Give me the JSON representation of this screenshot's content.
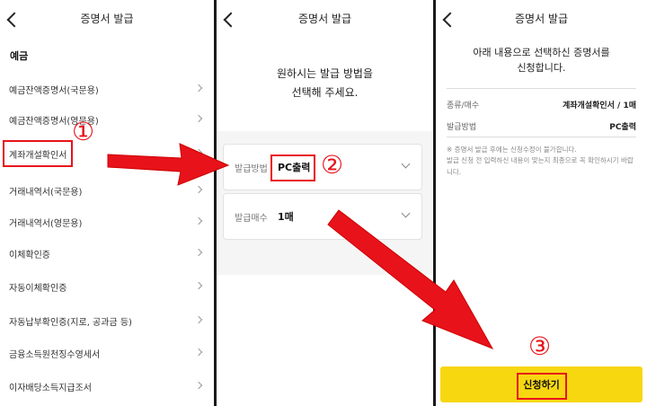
{
  "panel1": {
    "title": "증명서 발급",
    "section": "예금",
    "items": [
      {
        "label": "예금잔액증명서(국문용)"
      },
      {
        "label": "예금잔액증명서(영문용)"
      },
      {
        "label": "계좌개설확인서"
      },
      {
        "label": "거래내역서(국문용)"
      },
      {
        "label": "거래내역서(영문용)"
      },
      {
        "label": "이체확인증"
      },
      {
        "label": "자동이체확인증"
      },
      {
        "label": "자동납부확인증(지로, 공과금 등)"
      },
      {
        "label": "금융소득원천징수영세서"
      },
      {
        "label": "이자배당소득지급조서"
      }
    ]
  },
  "panel2": {
    "title": "증명서 발급",
    "prompt_line1": "원하시는 발급 방법을",
    "prompt_line2": "선택해 주세요.",
    "method_label": "발급방법",
    "method_value": "PC출력",
    "count_label": "발급매수",
    "count_value": "1매"
  },
  "panel3": {
    "title": "증명서 발급",
    "confirm_line1": "아래 내용으로 선택하신 증명서를",
    "confirm_line2": "신청합니다.",
    "row1_label": "종류/매수",
    "row1_value": "계좌개설확인서 / 1매",
    "row2_label": "발급방법",
    "row2_value": "PC출력",
    "note1": "※ 증명서 발급 후에는 신청수정이 불가합니다.",
    "note2": "발급 신청 전 입력하신 내용이 맞는지 최종으로 꼭 확인하시기 바랍니다.",
    "apply_label": "신청하기"
  },
  "annotations": {
    "step1": "①",
    "step2": "②",
    "step3": "③"
  },
  "colors": {
    "accent_yellow": "#f7d710",
    "annotation_red": "#e8121b"
  }
}
